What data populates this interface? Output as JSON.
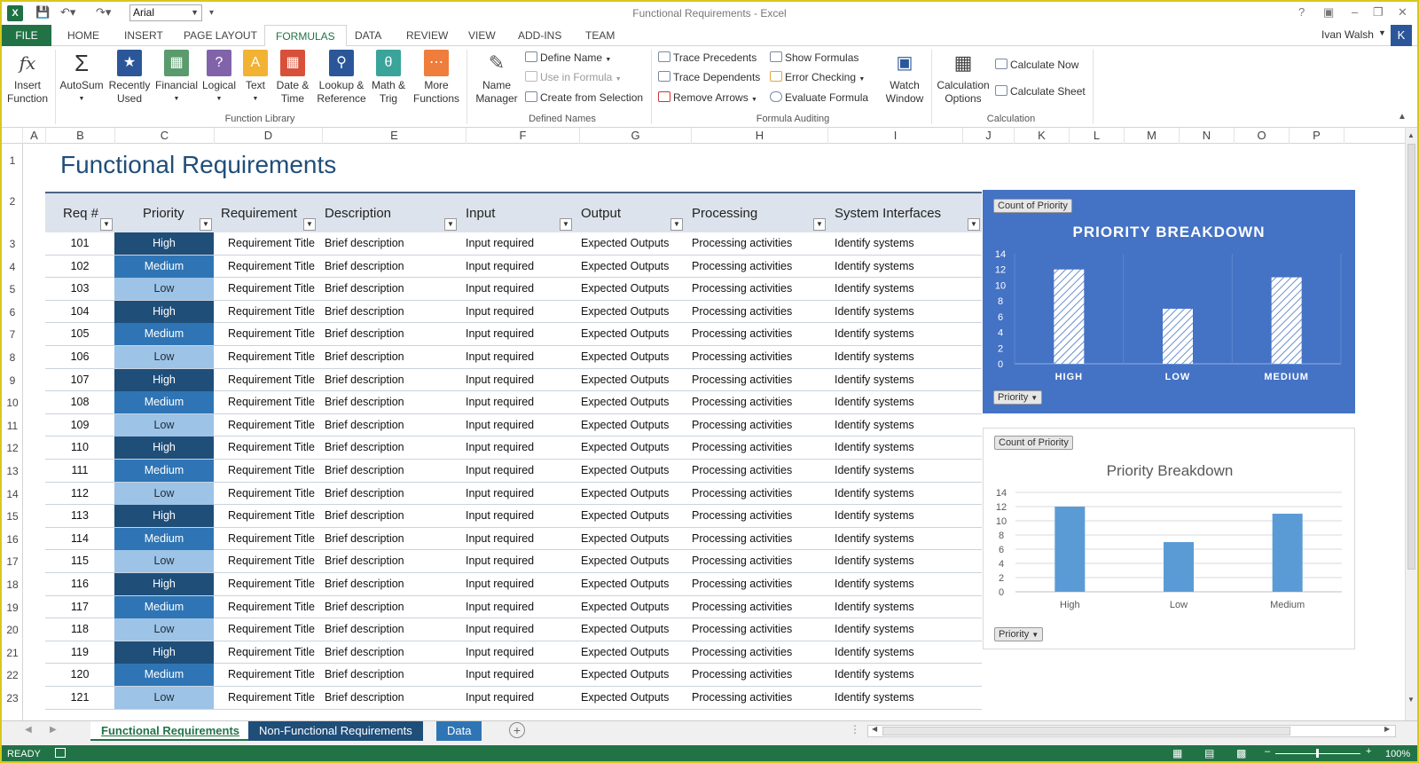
{
  "window": {
    "app_title": "Functional Requirements - Excel",
    "font_name": "Arial",
    "user_name": "Ivan Walsh",
    "user_initial": "K"
  },
  "tabs": {
    "file": "FILE",
    "items": [
      "HOME",
      "INSERT",
      "PAGE LAYOUT",
      "FORMULAS",
      "DATA",
      "REVIEW",
      "VIEW",
      "ADD-INS",
      "TEAM"
    ],
    "active": "FORMULAS"
  },
  "ribbon": {
    "insert_function": [
      "Insert",
      "Function"
    ],
    "autosum": "AutoSum",
    "recently_used": [
      "Recently",
      "Used"
    ],
    "financial": "Financial",
    "logical": "Logical",
    "text": "Text",
    "date_time": [
      "Date &",
      "Time"
    ],
    "lookup": [
      "Lookup &",
      "Reference"
    ],
    "math": [
      "Math &",
      "Trig"
    ],
    "more": [
      "More",
      "Functions"
    ],
    "function_library": "Function Library",
    "name_manager": [
      "Name",
      "Manager"
    ],
    "define_name": "Define Name",
    "use_in_formula": "Use in Formula",
    "create_from_selection": "Create from Selection",
    "defined_names": "Defined Names",
    "trace_precedents": "Trace Precedents",
    "trace_dependents": "Trace Dependents",
    "remove_arrows": "Remove Arrows",
    "show_formulas": "Show Formulas",
    "error_checking": "Error Checking",
    "evaluate_formula": "Evaluate Formula",
    "watch_window": [
      "Watch",
      "Window"
    ],
    "formula_auditing": "Formula Auditing",
    "calculation_options": [
      "Calculation",
      "Options"
    ],
    "calculate_now": "Calculate Now",
    "calculate_sheet": "Calculate Sheet",
    "calculation": "Calculation"
  },
  "columns": [
    "A",
    "B",
    "C",
    "D",
    "E",
    "F",
    "G",
    "H",
    "I",
    "J",
    "K",
    "L",
    "M",
    "N",
    "O",
    "P"
  ],
  "rows": [
    "1",
    "2",
    "3",
    "4",
    "5",
    "6",
    "7",
    "8",
    "9",
    "10",
    "11",
    "12",
    "13",
    "14",
    "15",
    "16",
    "17",
    "18",
    "19",
    "20",
    "21",
    "22",
    "23"
  ],
  "sheet": {
    "title": "Functional Requirements",
    "headers": [
      "Req #",
      "Priority",
      "Requirement",
      "Description",
      "Input",
      "Output",
      "Processing",
      "System Interfaces"
    ],
    "records": [
      [
        "101",
        "High"
      ],
      [
        "102",
        "Medium"
      ],
      [
        "103",
        "Low"
      ],
      [
        "104",
        "High"
      ],
      [
        "105",
        "Medium"
      ],
      [
        "106",
        "Low"
      ],
      [
        "107",
        "High"
      ],
      [
        "108",
        "Medium"
      ],
      [
        "109",
        "Low"
      ],
      [
        "110",
        "High"
      ],
      [
        "111",
        "Medium"
      ],
      [
        "112",
        "Low"
      ],
      [
        "113",
        "High"
      ],
      [
        "114",
        "Medium"
      ],
      [
        "115",
        "Low"
      ],
      [
        "116",
        "High"
      ],
      [
        "117",
        "Medium"
      ],
      [
        "118",
        "Low"
      ],
      [
        "119",
        "High"
      ],
      [
        "120",
        "Medium"
      ],
      [
        "121",
        "Low"
      ]
    ],
    "requirement_text": "Requirement Title",
    "description_text": "Brief description",
    "input_text": "Input required",
    "output_text": "Expected Outputs",
    "processing_text": "Processing activities",
    "interfaces_text": "Identify systems"
  },
  "chart_data": [
    {
      "type": "bar",
      "title": "PRIORITY BREAKDOWN",
      "field_button": "Count of Priority",
      "axis_button": "Priority",
      "categories": [
        "HIGH",
        "LOW",
        "MEDIUM"
      ],
      "values": [
        12,
        7,
        11
      ],
      "ylim": [
        0,
        14
      ],
      "yticks": [
        0,
        2,
        4,
        6,
        8,
        10,
        12,
        14
      ],
      "background": "#4472c4",
      "bar_style": "hatched-white"
    },
    {
      "type": "bar",
      "title": "Priority Breakdown",
      "field_button": "Count of Priority",
      "axis_button": "Priority",
      "categories": [
        "High",
        "Low",
        "Medium"
      ],
      "values": [
        12,
        7,
        11
      ],
      "ylim": [
        0,
        14
      ],
      "yticks": [
        0,
        2,
        4,
        6,
        8,
        10,
        12,
        14
      ],
      "bar_color": "#5b9bd5"
    }
  ],
  "sheet_tabs": [
    {
      "label": "Functional Requirements",
      "active": true
    },
    {
      "label": "Non-Functional Requirements",
      "active": false
    },
    {
      "label": "Data",
      "active": false
    }
  ],
  "status": {
    "ready": "READY",
    "zoom": "100%"
  },
  "colors": {
    "excel_green": "#217346",
    "high": "#1f4e79",
    "medium": "#2f75b5",
    "low": "#9dc3e6"
  }
}
